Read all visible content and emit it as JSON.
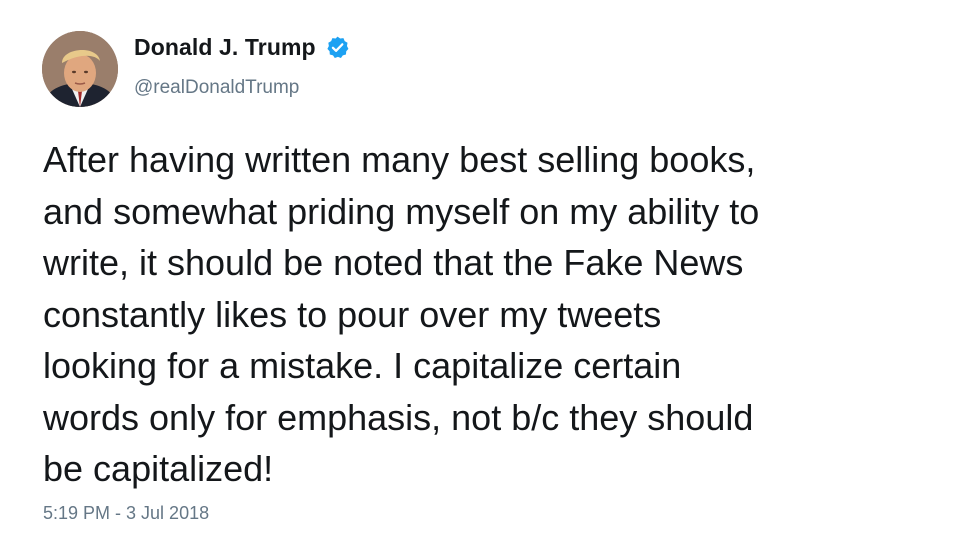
{
  "author": {
    "display_name": "Donald J. Trump",
    "handle": "@realDonaldTrump",
    "verified": true,
    "avatar_icon": "profile-photo",
    "verified_icon": "verified-badge-icon",
    "verified_color": "#1da1f2"
  },
  "tweet": {
    "lines": [
      "After having written many best selling books,",
      "and somewhat priding myself on my ability to",
      "write, it should be noted that the Fake News",
      "constantly likes to pour over my tweets",
      "looking for a mistake. I capitalize certain",
      "words only for emphasis, not b/c they should",
      "be capitalized!"
    ],
    "timestamp": "5:19 PM - 3 Jul 2018"
  },
  "colors": {
    "text": "#14171a",
    "secondary": "#657786",
    "background": "#ffffff"
  }
}
